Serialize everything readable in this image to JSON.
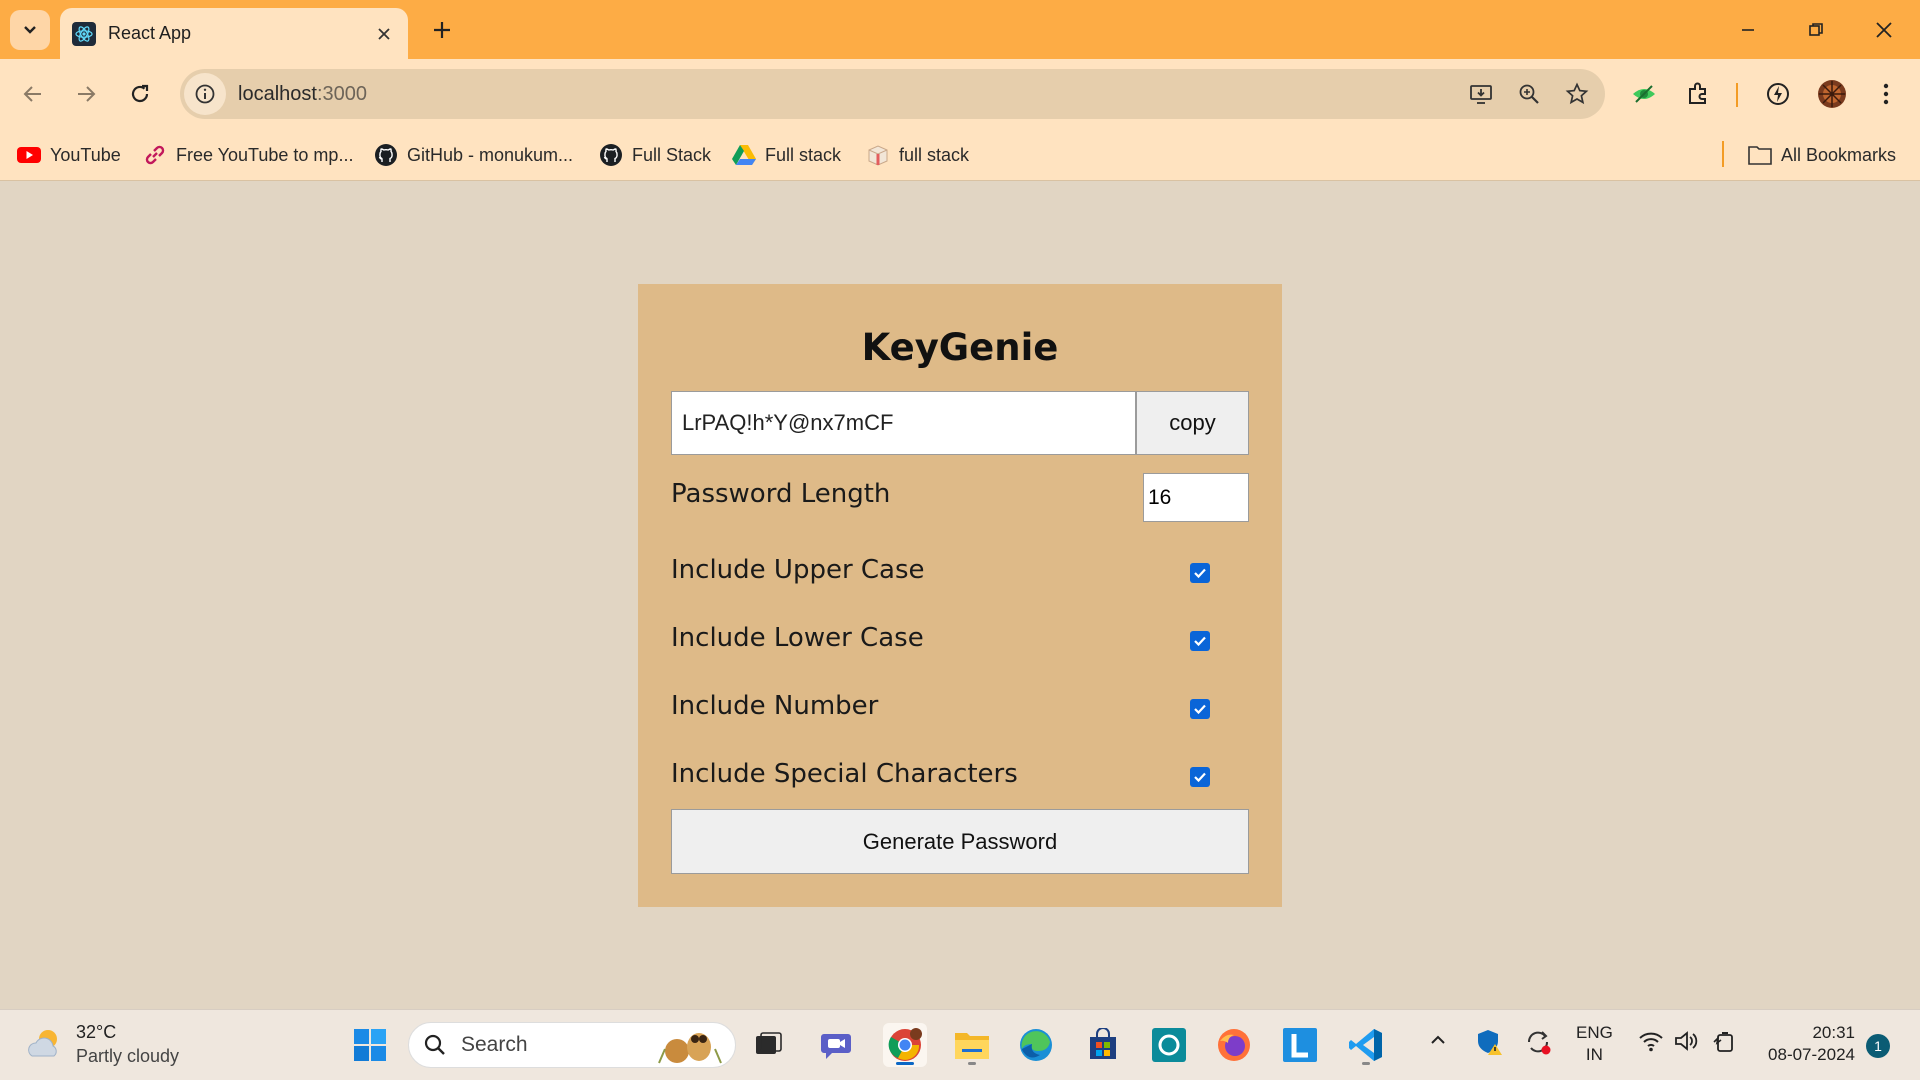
{
  "browser": {
    "tab_title": "React App",
    "url_host": "localhost",
    "url_port": ":3000"
  },
  "bookmarks": [
    {
      "label": "YouTube",
      "icon": "youtube-icon"
    },
    {
      "label": "Free YouTube to mp...",
      "icon": "link-icon"
    },
    {
      "label": "GitHub - monukum...",
      "icon": "github-icon"
    },
    {
      "label": "Full Stack",
      "icon": "github-icon"
    },
    {
      "label": "Full stack",
      "icon": "google-drive-icon"
    },
    {
      "label": "full stack",
      "icon": "box-icon"
    }
  ],
  "all_bookmarks": "All Bookmarks",
  "app": {
    "title": "KeyGenie",
    "password": "LrPAQ!h*Y@nx7mCF",
    "copy_label": "copy",
    "length_label": "Password Length",
    "length_value": "16",
    "options": [
      {
        "label": "Include Upper Case",
        "checked": true
      },
      {
        "label": "Include Lower Case",
        "checked": true
      },
      {
        "label": "Include Number",
        "checked": true
      },
      {
        "label": "Include Special Characters",
        "checked": true
      }
    ],
    "generate_label": "Generate Password"
  },
  "taskbar": {
    "temperature": "32°C",
    "weather_desc": "Partly cloudy",
    "search_label": "Search",
    "lang_top": "ENG",
    "lang_bottom": "IN",
    "time": "20:31",
    "date": "08-07-2024",
    "notification_count": "1"
  },
  "colors": {
    "tabstrip": "#fdac45",
    "toolbar": "#ffe3c0",
    "page_bg": "#e1d5c3",
    "card_bg": "#deba88",
    "checkbox": "#0a65d8"
  }
}
